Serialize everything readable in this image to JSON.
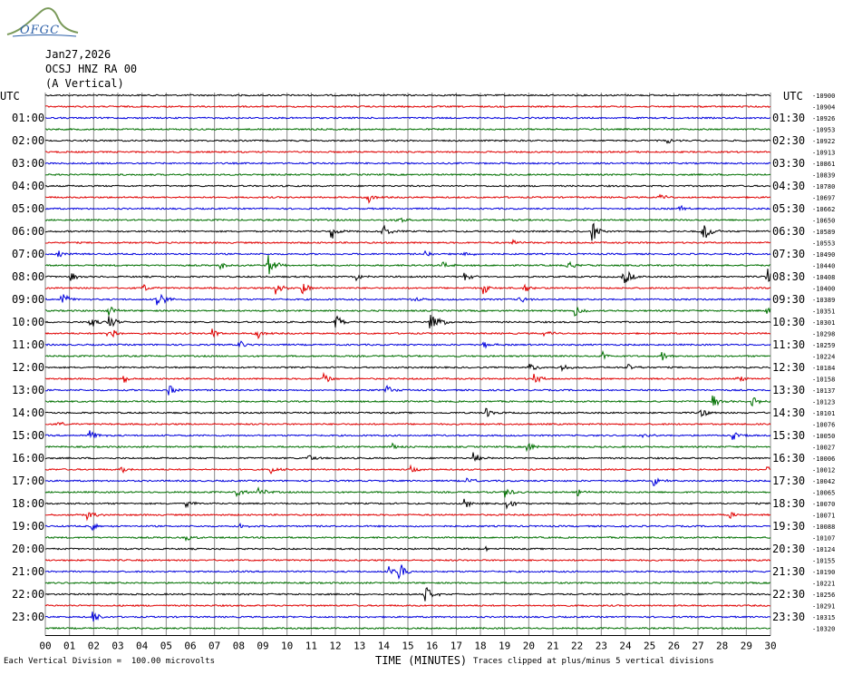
{
  "header": {
    "logo_text": "OFGC",
    "date": "Jan27,2026",
    "station": "OCSJ HNZ RA 00",
    "component": "(A Vertical)",
    "utc_left": "UTC",
    "utc_right": "UTC"
  },
  "colors": {
    "cycle": [
      "#000000",
      "#e00000",
      "#0000dd",
      "#007000"
    ],
    "grid": "#888888",
    "logo": "#2b5fa8"
  },
  "chart_data": {
    "type": "helicorder",
    "xlabel": "TIME (MINUTES)",
    "x_ticks": [
      "00",
      "01",
      "02",
      "03",
      "04",
      "05",
      "06",
      "07",
      "08",
      "09",
      "10",
      "11",
      "12",
      "13",
      "14",
      "15",
      "16",
      "17",
      "18",
      "19",
      "20",
      "21",
      "22",
      "23",
      "24",
      "25",
      "26",
      "27",
      "28",
      "29",
      "30"
    ],
    "xlim": [
      0,
      30
    ],
    "left_hour_labels": [
      "01:00",
      "02:00",
      "03:00",
      "04:00",
      "05:00",
      "06:00",
      "07:00",
      "08:00",
      "09:00",
      "10:00",
      "11:00",
      "12:00",
      "13:00",
      "14:00",
      "15:00",
      "16:00",
      "17:00",
      "18:00",
      "19:00",
      "20:00",
      "21:00",
      "22:00",
      "23:00"
    ],
    "right_hour_labels": [
      "01:30",
      "02:30",
      "03:30",
      "04:30",
      "05:30",
      "06:30",
      "07:30",
      "08:30",
      "09:30",
      "10:30",
      "11:30",
      "12:30",
      "13:30",
      "14:30",
      "15:30",
      "16:30",
      "17:30",
      "18:30",
      "19:30",
      "20:30",
      "21:30",
      "22:30",
      "23:30"
    ],
    "trace_offsets": [
      "-10900",
      "-10904",
      "-10926",
      "-10953",
      "-10922",
      "-10913",
      "-10861",
      "-10839",
      "-10780",
      "-10697",
      "-10662",
      "-10650",
      "-10589",
      "-10553",
      "-10490",
      "-10440",
      "-10408",
      "-10400",
      "-10389",
      "-10351",
      "-10301",
      "-10298",
      "-10259",
      "-10224",
      "-10184",
      "-10158",
      "-10137",
      "-10123",
      "-10101",
      "-10076",
      "-10050",
      "-10027",
      "-10006",
      "-10012",
      "-10042",
      "-10065",
      "-10070",
      "-10071",
      "-10088",
      "-10107",
      "-10124",
      "-10155",
      "-10190",
      "-10221",
      "-10256",
      "-10291",
      "-10315",
      "-10320"
    ],
    "footnote_left": "Each Vertical Division =  100.00 microvolts",
    "footnote_right": "Traces clipped at plus/minus 5 vertical divisions",
    "events": [
      {
        "trace": 4,
        "minute": 25.7,
        "amp": 3
      },
      {
        "trace": 9,
        "minute": 13.3,
        "amp": 8
      },
      {
        "trace": 9,
        "minute": 25.3,
        "amp": 6
      },
      {
        "trace": 10,
        "minute": 26.2,
        "amp": 4
      },
      {
        "trace": 11,
        "minute": 14.5,
        "amp": 7
      },
      {
        "trace": 12,
        "minute": 11.8,
        "amp": 11
      },
      {
        "trace": 12,
        "minute": 13.9,
        "amp": 10
      },
      {
        "trace": 12,
        "minute": 22.6,
        "amp": 13
      },
      {
        "trace": 12,
        "minute": 27.2,
        "amp": 14
      },
      {
        "trace": 13,
        "minute": 19.3,
        "amp": 4
      },
      {
        "trace": 14,
        "minute": 0.5,
        "amp": 6
      },
      {
        "trace": 14,
        "minute": 15.7,
        "amp": 5
      },
      {
        "trace": 14,
        "minute": 17.3,
        "amp": 4
      },
      {
        "trace": 15,
        "minute": 9.2,
        "amp": 14
      },
      {
        "trace": 15,
        "minute": 7.2,
        "amp": 5
      },
      {
        "trace": 15,
        "minute": 16.4,
        "amp": 5
      },
      {
        "trace": 15,
        "minute": 21.6,
        "amp": 7
      },
      {
        "trace": 16,
        "minute": 1.0,
        "amp": 7
      },
      {
        "trace": 16,
        "minute": 12.8,
        "amp": 6
      },
      {
        "trace": 16,
        "minute": 17.3,
        "amp": 5
      },
      {
        "trace": 16,
        "minute": 23.9,
        "amp": 12
      },
      {
        "trace": 16,
        "minute": 29.8,
        "amp": 14
      },
      {
        "trace": 17,
        "minute": 4.0,
        "amp": 6
      },
      {
        "trace": 17,
        "minute": 9.5,
        "amp": 9
      },
      {
        "trace": 17,
        "minute": 10.6,
        "amp": 8
      },
      {
        "trace": 17,
        "minute": 18.1,
        "amp": 7
      },
      {
        "trace": 17,
        "minute": 19.8,
        "amp": 6
      },
      {
        "trace": 18,
        "minute": 0.6,
        "amp": 12
      },
      {
        "trace": 18,
        "minute": 4.6,
        "amp": 13
      },
      {
        "trace": 18,
        "minute": 15.2,
        "amp": 5
      },
      {
        "trace": 18,
        "minute": 19.6,
        "amp": 5
      },
      {
        "trace": 19,
        "minute": 2.6,
        "amp": 7
      },
      {
        "trace": 19,
        "minute": 21.9,
        "amp": 6
      },
      {
        "trace": 19,
        "minute": 29.8,
        "amp": 5
      },
      {
        "trace": 20,
        "minute": 1.8,
        "amp": 9
      },
      {
        "trace": 20,
        "minute": 2.6,
        "amp": 10
      },
      {
        "trace": 20,
        "minute": 12.0,
        "amp": 9
      },
      {
        "trace": 20,
        "minute": 15.9,
        "amp": 14
      },
      {
        "trace": 20,
        "minute": 16.3,
        "amp": 6
      },
      {
        "trace": 21,
        "minute": 2.6,
        "amp": 14
      },
      {
        "trace": 21,
        "minute": 6.9,
        "amp": 6
      },
      {
        "trace": 21,
        "minute": 8.7,
        "amp": 8
      },
      {
        "trace": 21,
        "minute": 20.6,
        "amp": 6
      },
      {
        "trace": 22,
        "minute": 8.0,
        "amp": 6
      },
      {
        "trace": 22,
        "minute": 18.1,
        "amp": 5
      },
      {
        "trace": 23,
        "minute": 23.0,
        "amp": 6
      },
      {
        "trace": 23,
        "minute": 25.5,
        "amp": 6
      },
      {
        "trace": 24,
        "minute": 20.0,
        "amp": 7
      },
      {
        "trace": 24,
        "minute": 21.3,
        "amp": 6
      },
      {
        "trace": 24,
        "minute": 24.1,
        "amp": 5
      },
      {
        "trace": 25,
        "minute": 3.2,
        "amp": 6
      },
      {
        "trace": 25,
        "minute": 11.5,
        "amp": 6
      },
      {
        "trace": 25,
        "minute": 20.2,
        "amp": 7
      },
      {
        "trace": 25,
        "minute": 28.6,
        "amp": 6
      },
      {
        "trace": 26,
        "minute": 5.1,
        "amp": 7
      },
      {
        "trace": 26,
        "minute": 14.1,
        "amp": 6
      },
      {
        "trace": 27,
        "minute": 27.6,
        "amp": 8
      },
      {
        "trace": 27,
        "minute": 29.2,
        "amp": 7
      },
      {
        "trace": 28,
        "minute": 18.2,
        "amp": 7
      },
      {
        "trace": 28,
        "minute": 27.1,
        "amp": 6
      },
      {
        "trace": 29,
        "minute": 0.5,
        "amp": 4
      },
      {
        "trace": 30,
        "minute": 1.8,
        "amp": 7
      },
      {
        "trace": 30,
        "minute": 24.7,
        "amp": 4
      },
      {
        "trace": 30,
        "minute": 28.4,
        "amp": 6
      },
      {
        "trace": 31,
        "minute": 14.3,
        "amp": 6
      },
      {
        "trace": 31,
        "minute": 19.9,
        "amp": 8
      },
      {
        "trace": 32,
        "minute": 10.8,
        "amp": 6
      },
      {
        "trace": 32,
        "minute": 17.7,
        "amp": 6
      },
      {
        "trace": 33,
        "minute": 3.1,
        "amp": 6
      },
      {
        "trace": 33,
        "minute": 9.3,
        "amp": 6
      },
      {
        "trace": 33,
        "minute": 15.1,
        "amp": 4
      },
      {
        "trace": 33,
        "minute": 29.8,
        "amp": 6
      },
      {
        "trace": 34,
        "minute": 17.4,
        "amp": 6
      },
      {
        "trace": 34,
        "minute": 25.1,
        "amp": 8
      },
      {
        "trace": 35,
        "minute": 7.9,
        "amp": 6
      },
      {
        "trace": 35,
        "minute": 8.8,
        "amp": 7
      },
      {
        "trace": 35,
        "minute": 19.0,
        "amp": 8
      },
      {
        "trace": 35,
        "minute": 22.0,
        "amp": 5
      },
      {
        "trace": 36,
        "minute": 5.8,
        "amp": 5
      },
      {
        "trace": 36,
        "minute": 17.3,
        "amp": 6
      },
      {
        "trace": 36,
        "minute": 19.0,
        "amp": 9
      },
      {
        "trace": 37,
        "minute": 1.7,
        "amp": 7
      },
      {
        "trace": 37,
        "minute": 28.3,
        "amp": 5
      },
      {
        "trace": 38,
        "minute": 1.9,
        "amp": 5
      },
      {
        "trace": 38,
        "minute": 8.0,
        "amp": 3
      },
      {
        "trace": 39,
        "minute": 5.8,
        "amp": 5
      },
      {
        "trace": 40,
        "minute": 18.2,
        "amp": 3
      },
      {
        "trace": 42,
        "minute": 14.2,
        "amp": 6
      },
      {
        "trace": 42,
        "minute": 14.6,
        "amp": 13
      },
      {
        "trace": 44,
        "minute": 15.7,
        "amp": 11
      },
      {
        "trace": 46,
        "minute": 1.9,
        "amp": 9
      }
    ]
  }
}
